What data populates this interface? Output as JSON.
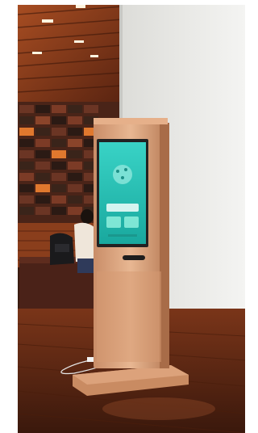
{
  "scene": {
    "subject": "kiosk",
    "colors": {
      "ceiling_wood": "#8b3e1e",
      "wall_white": "#eeeeec",
      "kiosk_frame": "#d8a07a",
      "kiosk_screen": "#23c3b8",
      "floor_wood": "#6b2e18"
    }
  },
  "kiosk": {
    "screen_title": "",
    "screen_button_main": "",
    "screen_button_left": "",
    "screen_button_right": "",
    "screen_footer": ""
  }
}
